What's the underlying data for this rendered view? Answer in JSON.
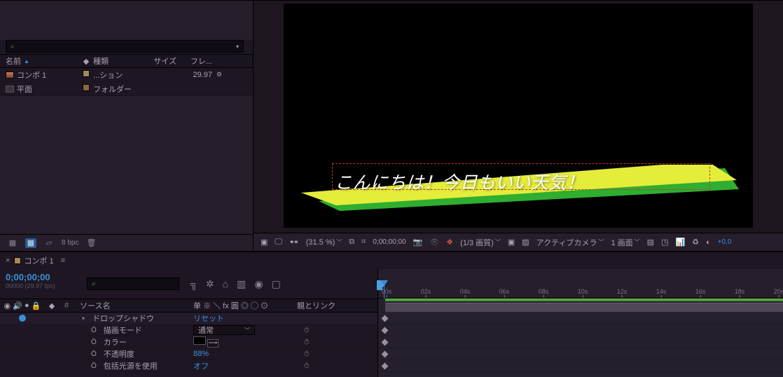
{
  "project": {
    "search_placeholder": "",
    "columns": {
      "name": "名前",
      "tag": "◆",
      "type": "種類",
      "size": "サイズ",
      "frame": "フレ..."
    },
    "rows": [
      {
        "name": "コンポ 1",
        "icon": "comp",
        "type": "...ション",
        "size": "",
        "frame": "29.97",
        "extra_icon": "share-icon"
      },
      {
        "name": "平面",
        "icon": "folder",
        "type": "フォルダー",
        "size": "",
        "frame": "",
        "extra_icon": ""
      }
    ],
    "footer_bpc": "8 bpc"
  },
  "viewer": {
    "telop_text": "こんにちは！今日もいい天気！",
    "controls": {
      "zoom": "(31.5 %)",
      "timecode": "0;00;00;00",
      "quality": "(1/3 画質)",
      "camera": "アクティブカメラ",
      "views": "1 画面",
      "exposure": "+0.0"
    }
  },
  "timeline": {
    "tab_name": "コンポ 1",
    "timecode": "0;00;00;00",
    "fps_line": "00000 (29.97 fps)",
    "search_placeholder": "",
    "columns": {
      "source": "ソース名",
      "switches": "单 ※ ＼ fx 圓 ◎ ◯ ⊙",
      "parent": "親とリンク",
      "num_hash": "#"
    },
    "ruler": [
      "00s",
      "02s",
      "04s",
      "06s",
      "08s",
      "10s",
      "12s",
      "14s",
      "16s",
      "18s",
      "20s"
    ],
    "effect": {
      "name": "ドロップシャドウ",
      "reset": "リセット",
      "props": [
        {
          "label": "描画モード",
          "value": "通常",
          "type": "dropdown"
        },
        {
          "label": "カラー",
          "value": "#000000",
          "type": "color"
        },
        {
          "label": "不透明度",
          "value": "88%",
          "type": "value"
        },
        {
          "label": "包括光源を使用",
          "value": "オフ",
          "type": "value"
        }
      ]
    }
  },
  "colors": {
    "accent_blue": "#3a8fd9",
    "panel": "#261e2b",
    "dark": "#1e1723"
  }
}
